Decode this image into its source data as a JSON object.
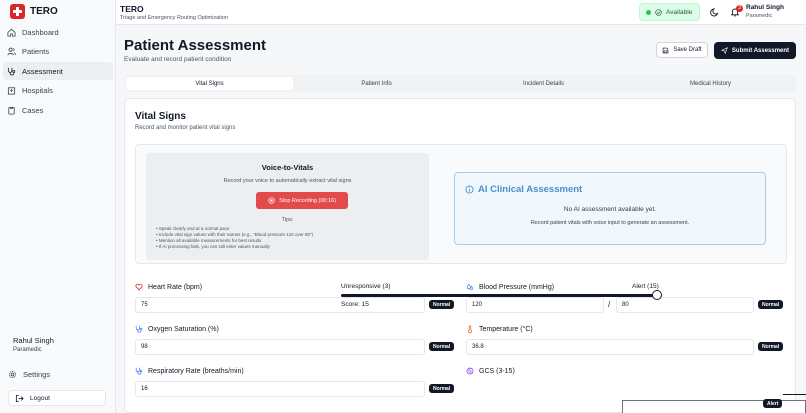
{
  "brand": {
    "name": "TERO"
  },
  "sidebar": {
    "items": [
      {
        "label": "Dashboard",
        "icon": "home-icon",
        "active": false
      },
      {
        "label": "Patients",
        "icon": "users-icon",
        "active": false
      },
      {
        "label": "Assessment",
        "icon": "stethoscope-icon",
        "active": true
      },
      {
        "label": "Hospitals",
        "icon": "hospital-icon",
        "active": false
      },
      {
        "label": "Cases",
        "icon": "clipboard-icon",
        "active": false
      }
    ],
    "user": {
      "name": "Rahul Singh",
      "role": "Paramedic"
    },
    "settings_label": "Settings",
    "logout_label": "Logout"
  },
  "header": {
    "title": "TERO",
    "subtitle": "Triage and Emergency Routing Optimization",
    "status": "Available",
    "notification_count": "3",
    "user_name": "Rahul Singh",
    "user_role": "Paramedic"
  },
  "page": {
    "title": "Patient Assessment",
    "subtitle": "Evaluate and record patient condition",
    "save_draft": "Save Draft",
    "submit": "Submit Assessment"
  },
  "tabs": [
    "Vital Signs",
    "Patient Info",
    "Incident Details",
    "Medical History"
  ],
  "vitals": {
    "title": "Vital Signs",
    "subtitle": "Record and monitor patient vital signs",
    "voice": {
      "title": "Voice-to-Vitals",
      "subtitle": "Record your voice to automatically extract vital signs",
      "stop_button": "Stop Recording (00:16)",
      "tips_title": "Tips:",
      "tips": [
        "Speak clearly and at a normal pace",
        "Include vital sign values with their names (e.g., \"Blood pressure 120 over 80\")",
        "Mention all available measurements for best results",
        "If AI processing fails, you can still enter values manually"
      ]
    },
    "ai": {
      "title": "AI Clinical Assessment",
      "empty": "No AI assessment available yet.",
      "help": "Record patient vitals with voice input to generate an assessment."
    },
    "heart_rate": {
      "label": "Heart Rate (bpm)",
      "value": "75",
      "status": "Normal"
    },
    "blood_pressure": {
      "label": "Blood Pressure (mmHg)",
      "systolic": "120",
      "separator": "/",
      "diastolic": "80",
      "status": "Normal"
    },
    "oxygen": {
      "label": "Oxygen Saturation (%)",
      "value": "98",
      "status": "Normal"
    },
    "temperature": {
      "label": "Temperature (°C)",
      "value": "36.8",
      "status": "Normal"
    },
    "respiratory": {
      "label": "Respiratory Rate (breaths/min)",
      "value": "16",
      "status": "Normal"
    },
    "gcs": {
      "label": "GCS (3-15)",
      "min_label": "Unresponsive (3)",
      "max_label": "Alert (15)",
      "score_text": "Score: 15",
      "status": "Alert",
      "value": 15,
      "min": 3,
      "max": 15
    }
  }
}
